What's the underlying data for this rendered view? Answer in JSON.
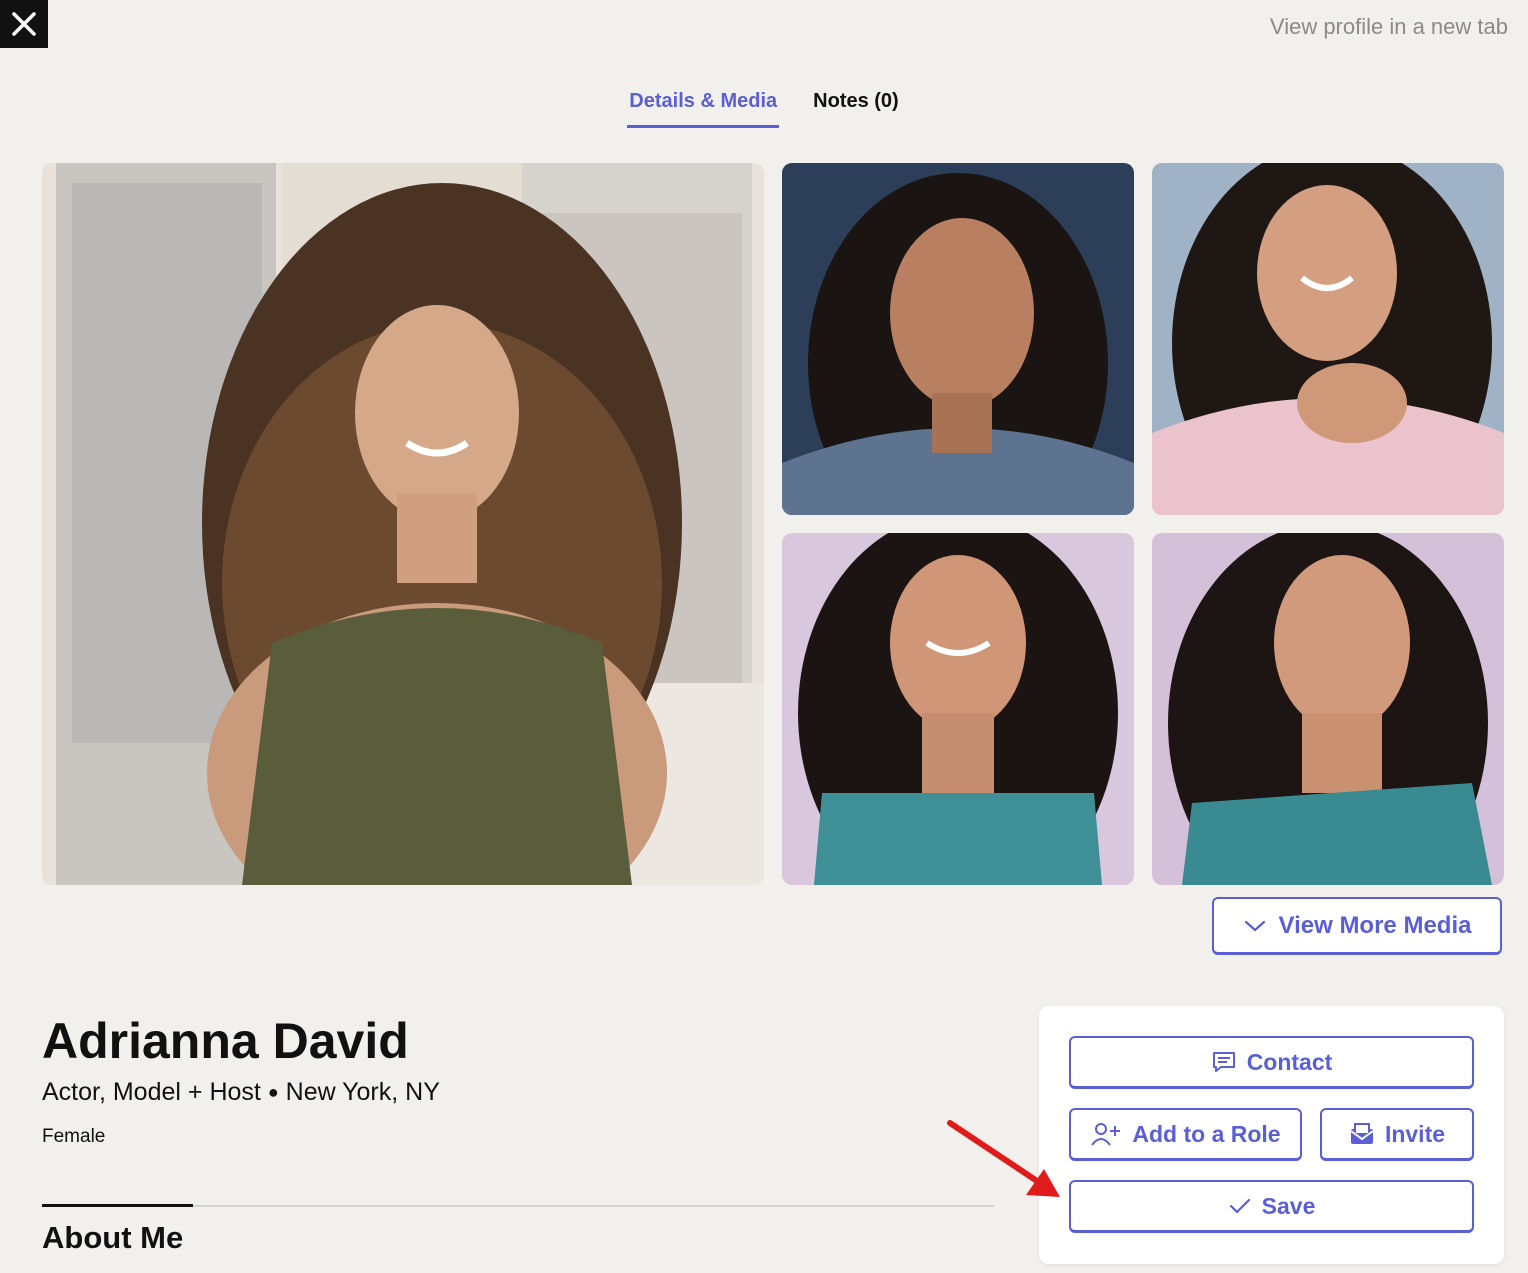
{
  "header": {
    "close_icon": "close-icon",
    "view_new_tab_label": "View profile in a new tab"
  },
  "tabs": [
    {
      "label": "Details & Media",
      "active": true
    },
    {
      "label": "Notes (0)",
      "active": false
    }
  ],
  "media": {
    "view_more_label": "View More Media",
    "view_more_icon": "chevron-down-icon"
  },
  "profile": {
    "name": "Adrianna David",
    "roles": "Actor, Model + Host",
    "separator": "●",
    "location": "New York, NY",
    "gender": "Female",
    "about_heading": "About Me"
  },
  "actions": {
    "contact_label": "Contact",
    "contact_icon": "message-icon",
    "add_role_label": "Add to a Role",
    "add_role_icon": "add-user-icon",
    "invite_label": "Invite",
    "invite_icon": "envelope-icon",
    "save_label": "Save",
    "save_icon": "check-icon"
  },
  "colors": {
    "accent": "#5a5fd6",
    "background": "#f2f0ec",
    "annotation_arrow": "#e01b1b"
  }
}
